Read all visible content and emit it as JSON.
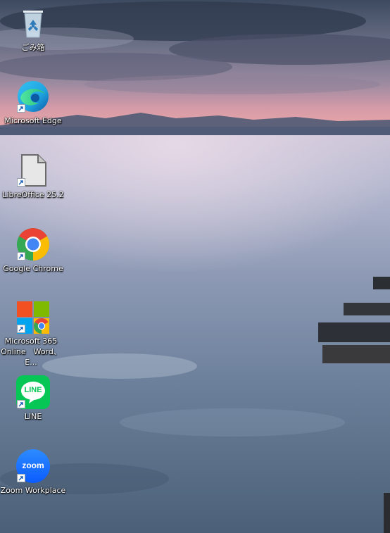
{
  "desktop": {
    "icons": [
      {
        "label": "ごみ箱",
        "icon": "recycle-bin-icon",
        "shortcut": false
      },
      {
        "label": "Microsoft Edge",
        "icon": "edge-icon",
        "shortcut": true
      },
      {
        "label": "LibreOffice 25.2",
        "icon": "libreoffice-icon",
        "shortcut": true
      },
      {
        "label": "Google Chrome",
        "icon": "chrome-icon",
        "shortcut": true
      },
      {
        "label": "Microsoft 365 Online　Word、E...",
        "icon": "microsoft-365-icon",
        "shortcut": true
      },
      {
        "label": "LINE",
        "icon": "line-icon",
        "shortcut": true,
        "logo_text": "LINE"
      },
      {
        "label": "Zoom Workplace",
        "icon": "zoom-icon",
        "shortcut": true,
        "logo_text": "zoom"
      }
    ]
  },
  "colors": {
    "edge": "#1fa3e0",
    "chrome_red": "#ea4335",
    "chrome_green": "#34a853",
    "chrome_yellow": "#fbbc05",
    "chrome_blue": "#4285f4",
    "line_green": "#06c755",
    "zoom_blue": "#0b5cff",
    "ms_red": "#f25022",
    "ms_green": "#7fba00",
    "ms_blue": "#00a4ef",
    "ms_yellow": "#ffb900"
  }
}
